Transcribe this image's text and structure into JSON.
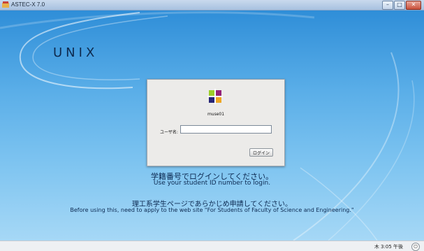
{
  "window": {
    "title": "ASTEC-X 7.0",
    "controls": {
      "minimize": "–",
      "maximize": "□",
      "close": "✕"
    }
  },
  "desktop": {
    "os_label": "UNIX"
  },
  "login": {
    "host": "muse01",
    "username_label": "ユーザ名:",
    "username_value": "",
    "login_button": "ログイン"
  },
  "messages": {
    "student_id_jp": "学籍番号でログインしてください。",
    "student_id_en": "Use your student ID number to login.",
    "apply_jp": "理工系学生ページであらかじめ申請してください。",
    "apply_en": "Before using this, need to apply to the web site \"For Students of Faculty of Science and Engineering.\""
  },
  "taskbar": {
    "clock": "木 3:05 午後",
    "power_icon": "⏻"
  },
  "icons": {
    "app": "astec-x-icon",
    "logo": "centos-logo-icon"
  }
}
